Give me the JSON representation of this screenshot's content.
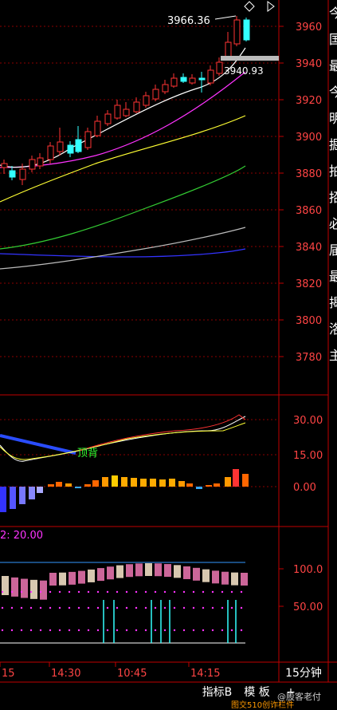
{
  "price_axis": {
    "labels": [
      "3960",
      "3940",
      "3920",
      "3900",
      "3880",
      "3860",
      "3840",
      "3820",
      "3800",
      "3780"
    ]
  },
  "price_values": [
    3960,
    3940,
    3920,
    3900,
    3880,
    3860,
    3840,
    3820,
    3800,
    3780
  ],
  "high_annotation": "3966.36",
  "last_price_label": "3940.93",
  "macd_axis": {
    "labels": [
      "30.00",
      "15.00",
      "0.00"
    ]
  },
  "macd_values": [
    30,
    15,
    0
  ],
  "divergence_label": "顶背",
  "osc_label": "2: 20.00",
  "osc_axis": {
    "labels": [
      "100.0",
      "50.00"
    ]
  },
  "osc_values": [
    100,
    50
  ],
  "time_axis": {
    "labels": [
      "15",
      "14:30",
      "10:45",
      "14:15"
    ]
  },
  "period_label": "15分钟",
  "bottom_tabs": [
    {
      "label": "指标B"
    },
    {
      "label": "模 板"
    },
    {
      "label": "+"
    }
  ],
  "watermark": "@股客老付",
  "bottom_strip_text": "图交510创诈栏件",
  "colors": {
    "grid": "#8b0000",
    "axis": "#c00000",
    "up": "#ff3333",
    "down": "#33ffff",
    "ma_white": "#ffffff",
    "ma_magenta": "#ff33ff",
    "ma_yellow": "#ffff33",
    "ma_green": "#33cc33",
    "ma_gray": "#bbbbbb",
    "ma_blue": "#3333ff"
  },
  "sidebar_glyphs": [
    "今",
    "国",
    "最",
    "今",
    "明",
    "掘",
    "拍",
    "招",
    "必",
    "届",
    "最",
    "揭",
    "洛",
    "主"
  ]
}
